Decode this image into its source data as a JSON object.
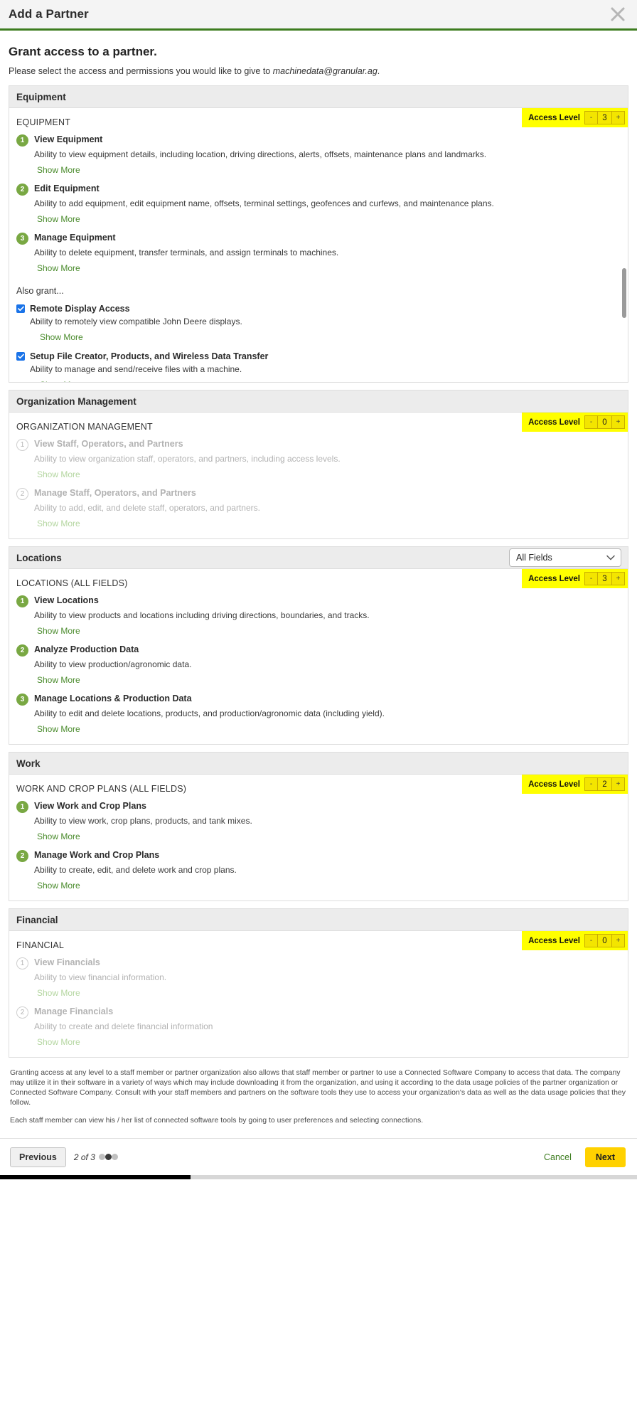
{
  "window": {
    "title": "Add a Partner",
    "close_icon": "close-icon"
  },
  "page": {
    "heading": "Grant access to a partner.",
    "subtitle_prefix": "Please select the access and permissions you would like to give to ",
    "subtitle_email": "machinedata@granular.ag",
    "subtitle_suffix": "."
  },
  "access_level_label": "Access Level",
  "stepper": {
    "minus": "-",
    "plus": "+"
  },
  "show_more_label": "Show More",
  "sections": [
    {
      "id": "equipment",
      "title": "Equipment",
      "category_label": "EQUIPMENT",
      "access_level": "3",
      "scrollable": true,
      "permissions": [
        {
          "num": "1",
          "title": "View Equipment",
          "desc": "Ability to view equipment details, including location, driving directions, alerts, offsets, maintenance plans and landmarks.",
          "disabled": false
        },
        {
          "num": "2",
          "title": "Edit Equipment",
          "desc": "Ability to add equipment, edit equipment name, offsets, terminal settings, geofences and curfews, and maintenance plans.",
          "disabled": false
        },
        {
          "num": "3",
          "title": "Manage Equipment",
          "desc": "Ability to delete equipment, transfer terminals, and assign terminals to machines.",
          "disabled": false
        }
      ],
      "also_grant_label": "Also grant...",
      "grants": [
        {
          "title": "Remote Display Access",
          "desc": "Ability to remotely view compatible John Deere displays.",
          "checked": true
        },
        {
          "title": "Setup File Creator, Products, and Wireless Data Transfer",
          "desc": "Ability to manage and send/receive files with a machine.",
          "checked": true
        }
      ]
    },
    {
      "id": "organization-management",
      "title": "Organization Management",
      "category_label": "ORGANIZATION MANAGEMENT",
      "access_level": "0",
      "scrollable": false,
      "permissions": [
        {
          "num": "1",
          "title": "View Staff, Operators, and Partners",
          "desc": "Ability to view organization staff, operators, and partners, including access levels.",
          "disabled": true
        },
        {
          "num": "2",
          "title": "Manage Staff, Operators, and Partners",
          "desc": "Ability to add, edit, and delete staff, operators, and partners.",
          "disabled": true
        }
      ]
    },
    {
      "id": "locations",
      "title": "Locations",
      "category_label": "LOCATIONS (ALL FIELDS)",
      "access_level": "3",
      "scrollable": false,
      "field_select": {
        "value": "All Fields",
        "options": [
          "All Fields"
        ]
      },
      "permissions": [
        {
          "num": "1",
          "title": "View Locations",
          "desc": "Ability to view products and locations including driving directions, boundaries, and tracks.",
          "disabled": false
        },
        {
          "num": "2",
          "title": "Analyze Production Data",
          "desc": "Ability to view production/agronomic data.",
          "disabled": false
        },
        {
          "num": "3",
          "title": "Manage Locations & Production Data",
          "desc": "Ability to edit and delete locations, products, and production/agronomic data (including yield).",
          "disabled": false
        }
      ]
    },
    {
      "id": "work",
      "title": "Work",
      "category_label": "WORK AND CROP PLANS (ALL FIELDS)",
      "access_level": "2",
      "scrollable": false,
      "permissions": [
        {
          "num": "1",
          "title": "View Work and Crop Plans",
          "desc": "Ability to view work, crop plans, products, and tank mixes.",
          "disabled": false
        },
        {
          "num": "2",
          "title": "Manage Work and Crop Plans",
          "desc": "Ability to create, edit, and delete work and crop plans.",
          "disabled": false
        }
      ]
    },
    {
      "id": "financial",
      "title": "Financial",
      "category_label": "FINANCIAL",
      "access_level": "0",
      "scrollable": false,
      "permissions": [
        {
          "num": "1",
          "title": "View Financials",
          "desc": "Ability to view financial information.",
          "disabled": true
        },
        {
          "num": "2",
          "title": "Manage Financials",
          "desc": "Ability to create and delete financial information",
          "disabled": true
        }
      ]
    }
  ],
  "disclaimer": [
    "Granting access at any level to a staff member or partner organization also allows that staff member or partner to use a Connected Software Company to access that data. The company may utilize it in their software in a variety of ways which may include downloading it from the organization, and using it according to the data usage policies of the partner organization or Connected Software Company. Consult with your staff members and partners on the software tools they use to access your organization's data as well as the data usage policies that they follow.",
    "Each staff member can view his / her list of connected software tools by going to user preferences and selecting connections."
  ],
  "footer": {
    "previous_label": "Previous",
    "pager_text": "2 of 3",
    "pager_total": 3,
    "pager_current": 2,
    "cancel_label": "Cancel",
    "next_label": "Next"
  },
  "colors": {
    "accent_green": "#3d7c1f",
    "highlight_yellow": "#ffff00",
    "next_yellow": "#ffd100",
    "badge_green": "#79a843",
    "checkbox_blue": "#1a73e8"
  }
}
